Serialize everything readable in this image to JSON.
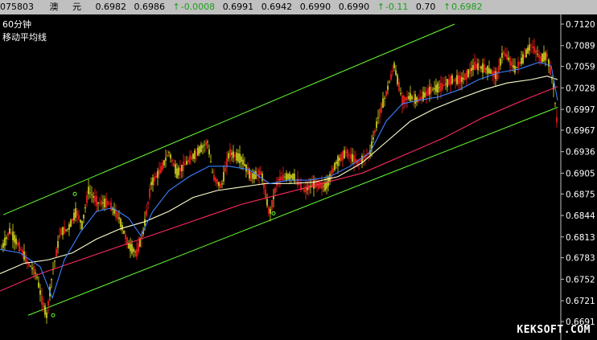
{
  "quote_bar": {
    "symbol": "075803",
    "name_1": "澳",
    "name_2": "元",
    "open": "0.6982",
    "high": "0.6986",
    "change": "-0.0008",
    "bid": "0.6991",
    "ask_low": "0.6942",
    "v1": "0.6990",
    "v2": "0.6990",
    "pct": "-0.11",
    "amp": "0.70",
    "last": "0.6982",
    "up_color": "#1a9e1a"
  },
  "panel": {
    "period_label": "60分钟",
    "indicator_label": "移动平均线",
    "watermark": "KEKSOFT.COM"
  },
  "chart_data": {
    "type": "line",
    "ylim": [
      0.6691,
      0.712
    ],
    "y_ticks": [
      "0.7120",
      "0.7089",
      "0.7059",
      "0.7028",
      "0.6997",
      "0.6967",
      "0.6936",
      "0.6905",
      "0.6875",
      "0.6844",
      "0.6813",
      "0.6783",
      "0.6752",
      "0.6721",
      "0.6691"
    ],
    "grid": false,
    "background": "#000000",
    "series": [
      {
        "role": "price-candles",
        "color": "#ff2020",
        "alt_color": "#e0e020",
        "x": [
          0,
          12,
          25,
          35,
          45,
          52,
          58,
          65,
          75,
          85,
          95,
          102,
          110,
          122,
          135,
          148,
          160,
          170,
          178,
          188,
          200,
          210,
          220,
          232,
          245,
          258,
          265,
          275,
          285,
          300,
          312,
          325,
          335,
          345,
          355,
          365,
          378,
          392,
          405,
          418,
          430,
          445,
          460,
          470,
          480,
          490,
          500,
          510,
          520,
          535,
          550,
          562,
          575,
          590,
          605,
          618,
          625,
          632,
          640,
          650,
          660,
          672,
          680,
          688,
          693
        ],
        "y": [
          0.679,
          0.6822,
          0.6797,
          0.6775,
          0.676,
          0.6722,
          0.67,
          0.676,
          0.682,
          0.6825,
          0.685,
          0.683,
          0.688,
          0.6862,
          0.6862,
          0.684,
          0.68,
          0.679,
          0.682,
          0.689,
          0.691,
          0.6935,
          0.6905,
          0.692,
          0.6935,
          0.695,
          0.69,
          0.6885,
          0.6935,
          0.6925,
          0.69,
          0.6905,
          0.6845,
          0.6895,
          0.69,
          0.69,
          0.688,
          0.689,
          0.6885,
          0.692,
          0.6935,
          0.692,
          0.6935,
          0.6985,
          0.702,
          0.706,
          0.701,
          0.7015,
          0.701,
          0.7025,
          0.703,
          0.704,
          0.704,
          0.706,
          0.7055,
          0.7045,
          0.708,
          0.707,
          0.7055,
          0.707,
          0.709,
          0.707,
          0.7075,
          0.703,
          0.697
        ]
      },
      {
        "role": "ma-fast",
        "color": "#3a7fff",
        "x": [
          0,
          25,
          50,
          65,
          80,
          100,
          120,
          140,
          160,
          175,
          190,
          210,
          235,
          260,
          285,
          310,
          335,
          360,
          385,
          410,
          435,
          460,
          480,
          500,
          520,
          545,
          570,
          595,
          620,
          645,
          670,
          685,
          693
        ],
        "y": [
          0.6795,
          0.679,
          0.677,
          0.6725,
          0.678,
          0.682,
          0.685,
          0.6855,
          0.684,
          0.6815,
          0.685,
          0.688,
          0.69,
          0.6915,
          0.6915,
          0.691,
          0.689,
          0.6895,
          0.6895,
          0.69,
          0.6915,
          0.6935,
          0.698,
          0.7005,
          0.701,
          0.7015,
          0.7025,
          0.704,
          0.705,
          0.7055,
          0.7065,
          0.706,
          0.701
        ]
      },
      {
        "role": "ma-medium",
        "color": "#ffffd0",
        "x": [
          0,
          30,
          60,
          90,
          120,
          150,
          180,
          210,
          240,
          270,
          300,
          330,
          360,
          390,
          420,
          450,
          480,
          510,
          540,
          570,
          600,
          630,
          660,
          680,
          693
        ],
        "y": [
          0.676,
          0.6775,
          0.678,
          0.679,
          0.681,
          0.6825,
          0.6835,
          0.685,
          0.687,
          0.688,
          0.6885,
          0.689,
          0.689,
          0.6892,
          0.69,
          0.692,
          0.695,
          0.698,
          0.6998,
          0.7012,
          0.7025,
          0.7035,
          0.704,
          0.7045,
          0.704
        ]
      },
      {
        "role": "ma-slow",
        "color": "#ff2a60",
        "x": [
          0,
          50,
          100,
          150,
          200,
          250,
          300,
          350,
          400,
          450,
          500,
          550,
          600,
          650,
          693
        ],
        "y": [
          0.6735,
          0.676,
          0.678,
          0.68,
          0.682,
          0.684,
          0.686,
          0.6875,
          0.689,
          0.6905,
          0.693,
          0.6955,
          0.6985,
          0.701,
          0.703
        ]
      },
      {
        "role": "channel-upper",
        "color": "#66ff33",
        "x": [
          4,
          565
        ],
        "y": [
          0.6845,
          0.712
        ]
      },
      {
        "role": "channel-lower",
        "color": "#66ff33",
        "x": [
          35,
          693
        ],
        "y": [
          0.67,
          0.7
        ]
      }
    ],
    "x_domain": [
      0,
      742
    ]
  }
}
